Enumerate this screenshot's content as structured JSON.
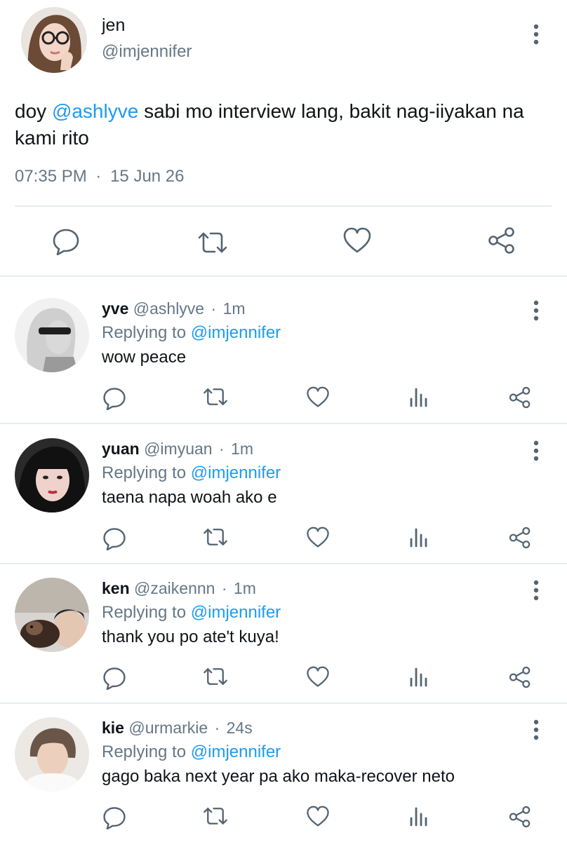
{
  "tweet": {
    "name": "jen",
    "handle": "@imjennifer",
    "text_before": "doy ",
    "mention": "@ashlyve",
    "text_after": " sabi mo interview lang, bakit nag-iiyakan na kami rito",
    "time": "07:35 PM",
    "separator": "·",
    "date": "15 Jun 26",
    "actions": [
      "reply-icon",
      "retweet-icon",
      "like-icon",
      "share-icon"
    ]
  },
  "replies": [
    {
      "name": "yve",
      "handle": "@ashlyve",
      "dot": "·",
      "time": "1m",
      "replying_label": "Replying to",
      "replying_to": "@imjennifer",
      "text": "wow peace"
    },
    {
      "name": "yuan",
      "handle": "@imyuan",
      "dot": "·",
      "time": "1m",
      "replying_label": "Replying to",
      "replying_to": "@imjennifer",
      "text": "taena napa woah ako e"
    },
    {
      "name": "ken",
      "handle": "@zaikennn",
      "dot": "·",
      "time": "1m",
      "replying_label": "Replying to",
      "replying_to": "@imjennifer",
      "text": "thank you po ate't kuya!"
    },
    {
      "name": "kie",
      "handle": "@urmarkie",
      "dot": "·",
      "time": "24s",
      "replying_label": "Replying to",
      "replying_to": "@imjennifer",
      "text": "gago baka next year pa ako maka-recover neto"
    }
  ],
  "reply_actions": [
    "reply-icon",
    "retweet-icon",
    "like-icon",
    "analytics-icon",
    "share-icon"
  ],
  "colors": {
    "mention": "#1d9bf0",
    "muted": "#657786",
    "icon": "#536471",
    "divider": "#e6ecf0"
  }
}
